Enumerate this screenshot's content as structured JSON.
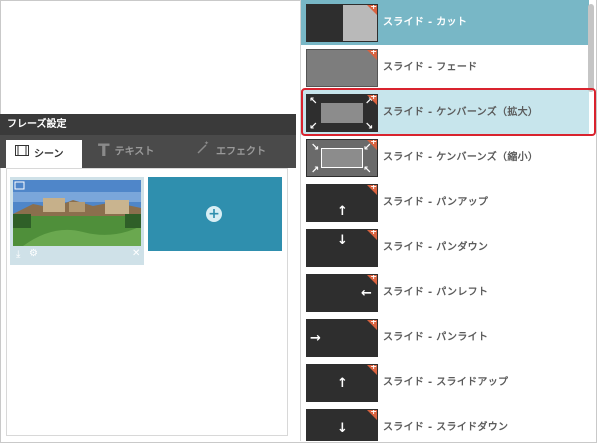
{
  "phrase_panel": {
    "title": "フレーズ設定",
    "tabs": [
      {
        "label": "シーン",
        "icon": "film-icon",
        "active": true
      },
      {
        "label": "テキスト",
        "icon": "text-t-icon",
        "active": false
      },
      {
        "label": "エフェクト",
        "icon": "magic-wand-icon",
        "active": false
      }
    ],
    "add_scene_icon": "plus-circle-icon",
    "thumb_tools": [
      "replace-icon",
      "gear-icon",
      "close-icon"
    ]
  },
  "transitions": [
    {
      "label": "スライド - カット",
      "state": "selected"
    },
    {
      "label": "スライド - フェード",
      "state": "normal"
    },
    {
      "label": "スライド - ケンバーンズ（拡大）",
      "state": "highlighted"
    },
    {
      "label": "スライド - ケンバーンズ（縮小）",
      "state": "normal"
    },
    {
      "label": "スライド - パンアップ",
      "state": "normal"
    },
    {
      "label": "スライド - パンダウン",
      "state": "normal"
    },
    {
      "label": "スライド - パンレフト",
      "state": "normal"
    },
    {
      "label": "スライド - パンライト",
      "state": "normal"
    },
    {
      "label": "スライド - スライドアップ",
      "state": "normal"
    },
    {
      "label": "スライド - スライドダウン",
      "state": "normal"
    }
  ],
  "colors": {
    "accent": "#2f8fae",
    "selected_row": "#78b7c6",
    "highlight_row": "#c7e5ec",
    "badge": "#d9623f",
    "callout": "#d9232e"
  }
}
